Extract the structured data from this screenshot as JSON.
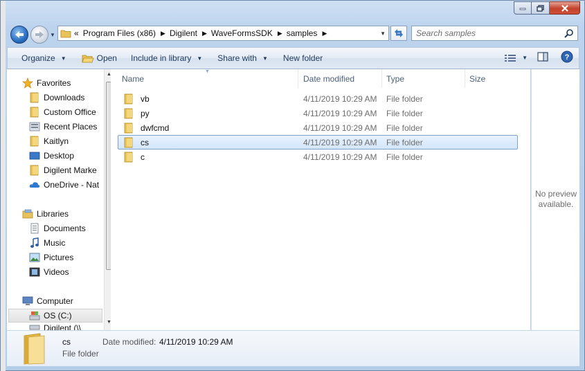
{
  "address": {
    "overflow": "«",
    "crumbs": [
      "Program Files (x86)",
      "Digilent",
      "WaveFormsSDK",
      "samples"
    ]
  },
  "search": {
    "placeholder": "Search samples"
  },
  "toolbar": {
    "organize": "Organize",
    "open": "Open",
    "include_in_library": "Include in library",
    "share_with": "Share with",
    "new_folder": "New folder"
  },
  "nav": {
    "favorites": "Favorites",
    "downloads": "Downloads",
    "custom_office": "Custom Office",
    "recent_places": "Recent Places",
    "kaitlyn": "Kaitlyn",
    "desktop": "Desktop",
    "digilent_marketing": "Digilent Marke",
    "onedrive": "OneDrive - Nat",
    "libraries": "Libraries",
    "documents": "Documents",
    "music": "Music",
    "pictures": "Pictures",
    "videos": "Videos",
    "computer": "Computer",
    "os_c": "OS (C:)",
    "digilent_drive": "Digilent (\\\\"
  },
  "columns": {
    "name": "Name",
    "date_modified": "Date modified",
    "type": "Type",
    "size": "Size"
  },
  "files": [
    {
      "name": "vb",
      "date": "4/11/2019 10:29 AM",
      "type": "File folder",
      "selected": false
    },
    {
      "name": "py",
      "date": "4/11/2019 10:29 AM",
      "type": "File folder",
      "selected": false
    },
    {
      "name": "dwfcmd",
      "date": "4/11/2019 10:29 AM",
      "type": "File folder",
      "selected": false
    },
    {
      "name": "cs",
      "date": "4/11/2019 10:29 AM",
      "type": "File folder",
      "selected": true
    },
    {
      "name": "c",
      "date": "4/11/2019 10:29 AM",
      "type": "File folder",
      "selected": false
    }
  ],
  "preview": {
    "line1": "No preview",
    "line2": "available."
  },
  "details": {
    "name": "cs",
    "type": "File folder",
    "date_label": "Date modified:",
    "date_value": "4/11/2019 10:29 AM"
  },
  "colors": {
    "selection": "#d3e6fb",
    "selection_border": "#7da2ce",
    "folder": "#e8c25a"
  }
}
